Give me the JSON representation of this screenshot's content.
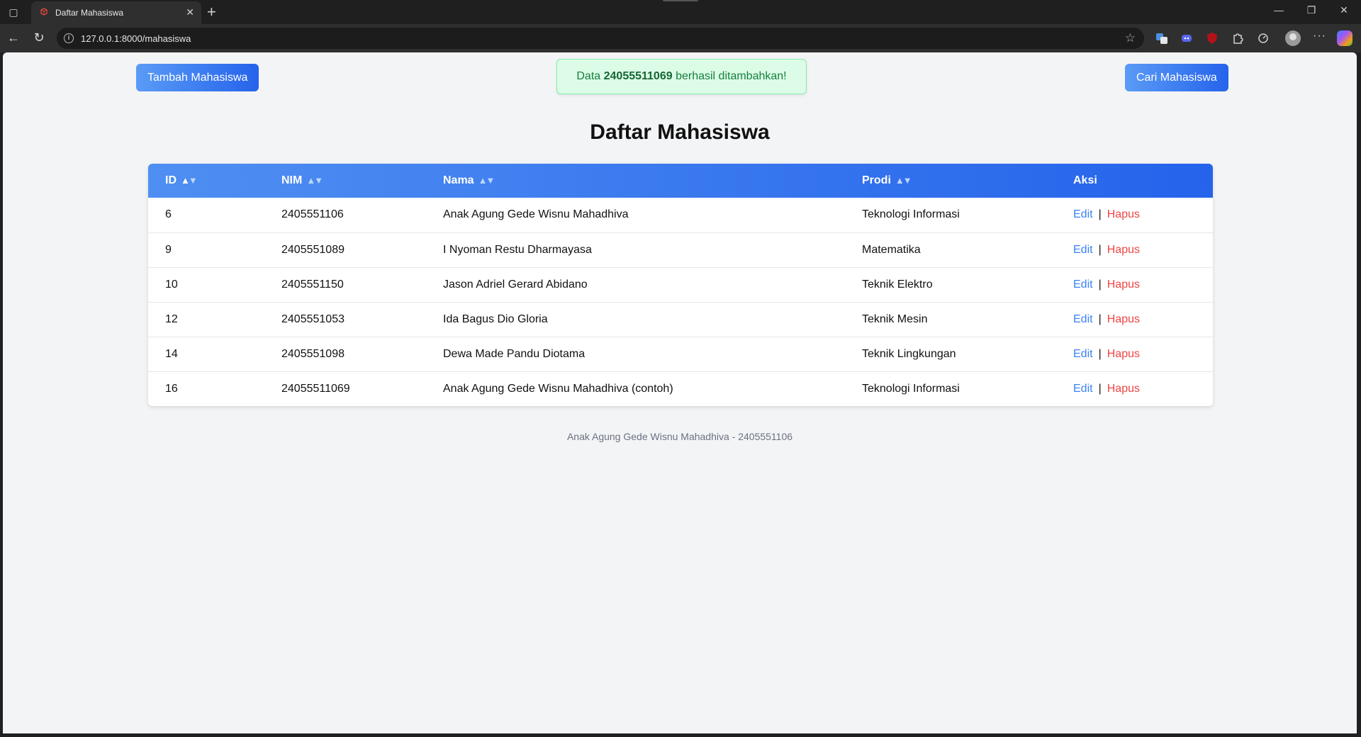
{
  "browser": {
    "tab_title": "Daftar Mahasiswa",
    "url": "127.0.0.1:8000/mahasiswa"
  },
  "page": {
    "add_button": "Tambah Mahasiswa",
    "search_button": "Cari Mahasiswa",
    "alert": {
      "prefix": "Data ",
      "nim": "24055511069",
      "suffix": " berhasil ditambahkan!"
    },
    "title": "Daftar Mahasiswa",
    "footer": "Anak Agung Gede Wisnu Mahadhiva - 2405551106"
  },
  "table": {
    "headers": {
      "id": "ID",
      "nim": "NIM",
      "nama": "Nama",
      "prodi": "Prodi",
      "aksi": "Aksi"
    },
    "action_edit": "Edit",
    "action_separator": "|",
    "action_delete": "Hapus",
    "rows": [
      {
        "id": "6",
        "nim": "2405551106",
        "nama": "Anak Agung Gede Wisnu Mahadhiva",
        "prodi": "Teknologi Informasi"
      },
      {
        "id": "9",
        "nim": "2405551089",
        "nama": "I Nyoman Restu Dharmayasa",
        "prodi": "Matematika"
      },
      {
        "id": "10",
        "nim": "2405551150",
        "nama": "Jason Adriel Gerard Abidano",
        "prodi": "Teknik Elektro"
      },
      {
        "id": "12",
        "nim": "2405551053",
        "nama": "Ida Bagus Dio Gloria",
        "prodi": "Teknik Mesin"
      },
      {
        "id": "14",
        "nim": "2405551098",
        "nama": "Dewa Made Pandu Diotama",
        "prodi": "Teknik Lingkungan"
      },
      {
        "id": "16",
        "nim": "24055511069",
        "nama": "Anak Agung Gede Wisnu Mahadhiva (contoh)",
        "prodi": "Teknologi Informasi"
      }
    ]
  },
  "colors": {
    "accent": "#2563eb",
    "accent_light": "#5a9bf6",
    "edit_link": "#3b82f6",
    "delete_link": "#ef4444",
    "alert_bg": "#dcfce7",
    "alert_text": "#15803d"
  }
}
